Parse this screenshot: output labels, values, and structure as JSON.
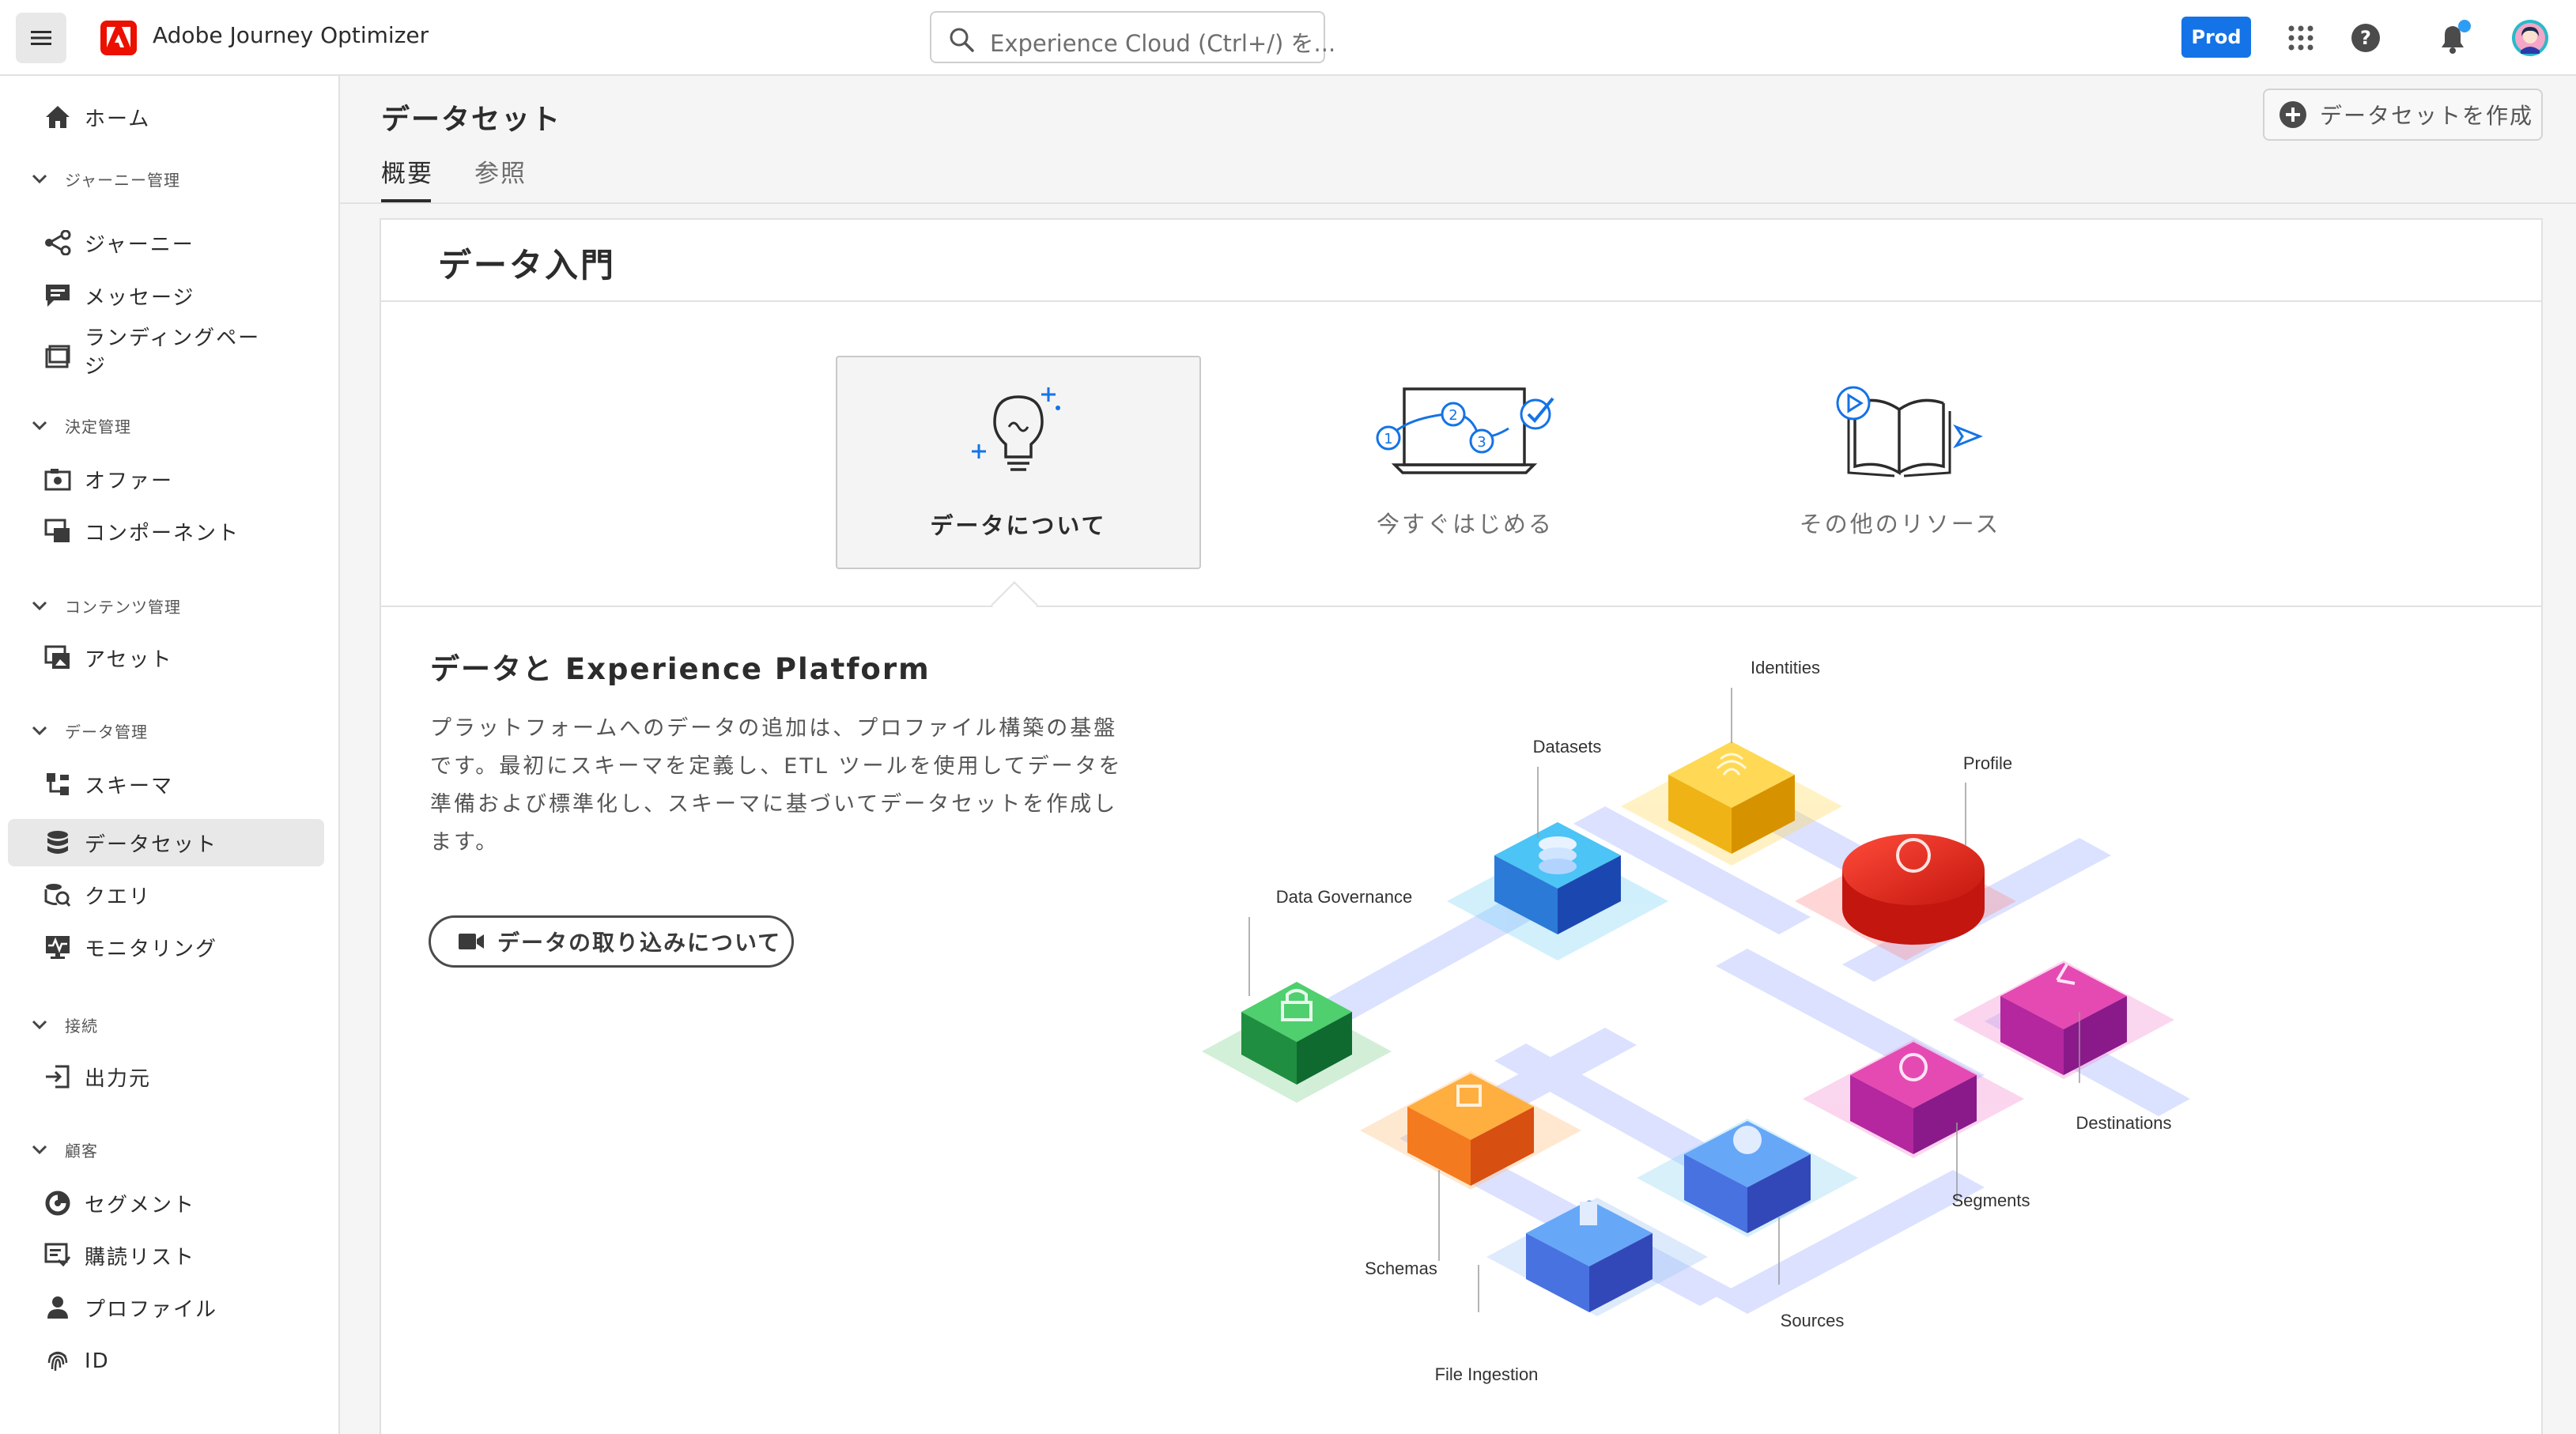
{
  "header": {
    "app_name": "Adobe Journey Optimizer",
    "search_placeholder": "Experience Cloud (Ctrl+/) を...",
    "env_label": "Prod",
    "icons": [
      "menu-icon",
      "adobe-logo-icon",
      "search-icon",
      "apps-grid-icon",
      "help-icon",
      "bell-icon",
      "avatar"
    ]
  },
  "sidebar": {
    "home": "ホーム",
    "groups": {
      "journey": "ジャーニー管理",
      "decision": "決定管理",
      "content": "コンテンツ管理",
      "data": "データ管理",
      "connections": "接続",
      "customers": "顧客"
    },
    "items": {
      "journeys": "ジャーニー",
      "messages": "メッセージ",
      "landing_pages": "ランディングページ",
      "offers": "オファー",
      "components": "コンポーネント",
      "assets": "アセット",
      "schemas": "スキーマ",
      "datasets": "データセット",
      "queries": "クエリ",
      "monitoring": "モニタリング",
      "destinations": "出力元",
      "segments": "セグメント",
      "subscription_lists": "購読リスト",
      "profiles": "プロファイル",
      "identities": "ID"
    },
    "active_item": "datasets"
  },
  "page": {
    "title": "データセット",
    "create_button": "データセットを作成",
    "tabs": [
      "概要",
      "参照"
    ],
    "active_tab": "概要"
  },
  "card": {
    "title": "データ入門",
    "options": [
      {
        "label": "データについて",
        "icon": "lightbulb-icon",
        "selected": true
      },
      {
        "label": "今すぐはじめる",
        "icon": "laptop-steps-icon",
        "selected": false
      },
      {
        "label": "その他のリソース",
        "icon": "book-video-icon",
        "selected": false
      }
    ],
    "section_title": "データと Experience Platform",
    "section_body": "プラットフォームへのデータの追加は、プロファイル構築の基盤です。最初にスキーマを定義し、ETL ツールを使用してデータを準備および標準化し、スキーマに基づいてデータセットを作成します。",
    "cta_label": "データの取り込みについて",
    "diagram_labels": {
      "identities": "Identities",
      "datasets": "Datasets",
      "profile": "Profile",
      "data_governance": "Data Governance",
      "destinations": "Destinations",
      "segments": "Segments",
      "schemas": "Schemas",
      "sources": "Sources",
      "file_ingestion": "File Ingestion"
    }
  },
  "colors": {
    "accent_blue": "#1473e6",
    "adobe_red": "#eb1000",
    "notification_dot": "#2d9cf6"
  }
}
